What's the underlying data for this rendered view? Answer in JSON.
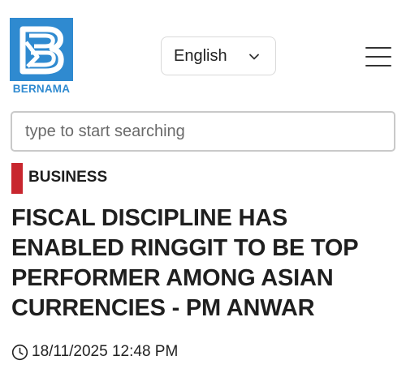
{
  "header": {
    "logo_text": "BERNAMA",
    "logo_icon": "bernama-b-logo-icon",
    "language": {
      "selected": "English",
      "icon": "chevron-down-icon"
    },
    "menu_icon": "hamburger-menu-icon"
  },
  "search": {
    "placeholder": "type to start searching",
    "value": ""
  },
  "article": {
    "category": "BUSINESS",
    "headline": "FISCAL DISCIPLINE HAS ENABLED RINGGIT TO BE TOP PERFORMER AMONG ASIAN CURRENCIES - PM ANWAR",
    "timestamp": "18/11/2025 12:48 PM",
    "timestamp_icon": "clock-icon"
  },
  "colors": {
    "brand_blue": "#2f8ad0",
    "category_red": "#c8262e",
    "text_dark": "#1f1f1f"
  }
}
